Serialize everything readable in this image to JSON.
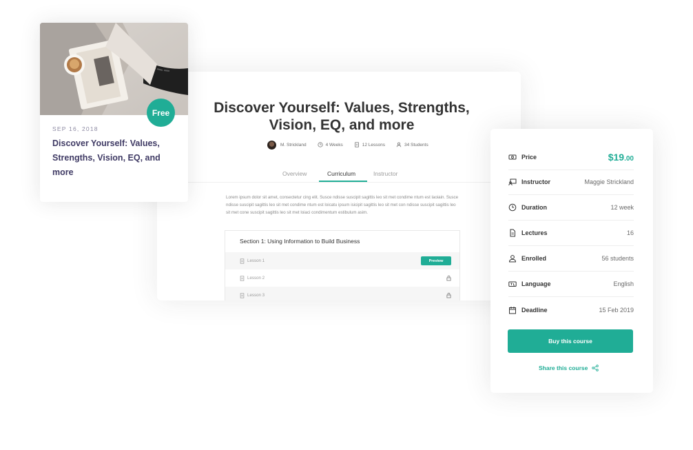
{
  "course": {
    "title": "Discover Yourself: Values, Strengths, Vision, EQ, and more",
    "instructor": "M. Strickland",
    "duration": "4 Weeks",
    "lessons": "12 Lessons",
    "students": "34 Students",
    "tabs": [
      "Overview",
      "Curriculum",
      "Instructor"
    ],
    "active_tab": "Curriculum",
    "description": "Lorem ipsum dolor sit amet, consectetur cing elit. Susce ndisse suscipit sagittis leo sit met condime ntum est laoiain. Susce ndisse suscipit sagittis leo sit met condime ntum est loicatu ipsum isicipit sagittis leo sit met con ndisse suscipit sagittis leo sit met cone suscipit sagittis leo sit met loiaci condimentum estibulum asim.",
    "section": {
      "title": "Section 1: Using Information to Build Business",
      "lessons": [
        {
          "label": "Lesson 1",
          "action": "Preview"
        },
        {
          "label": "Lesson 2",
          "action": "locked"
        },
        {
          "label": "Lesson 3",
          "action": "locked"
        }
      ]
    }
  },
  "card": {
    "date": "SEP 16, 2018",
    "title": "Discover Yourself: Values, Strengths, Vision, EQ, and more",
    "badge": "Free"
  },
  "sidebar": {
    "price_label": "Price",
    "price_main": "$19",
    "price_cents": ".00",
    "rows": [
      {
        "label": "Instructor",
        "value": "Maggie Strickland",
        "icon": "chalkboard-icon"
      },
      {
        "label": "Duration",
        "value": "12 week",
        "icon": "clock-icon"
      },
      {
        "label": "Lectures",
        "value": "16",
        "icon": "file-icon"
      },
      {
        "label": "Enrolled",
        "value": "56 students",
        "icon": "user-icon"
      },
      {
        "label": "Language",
        "value": "English",
        "icon": "language-icon"
      },
      {
        "label": "Deadline",
        "value": "15 Feb 2019",
        "icon": "calendar-icon"
      }
    ],
    "buy_label": "Buy this course",
    "share_label": "Share this course"
  },
  "colors": {
    "accent": "#20ad96",
    "heading": "#3f3a64",
    "text": "#333333",
    "muted": "#696969"
  }
}
